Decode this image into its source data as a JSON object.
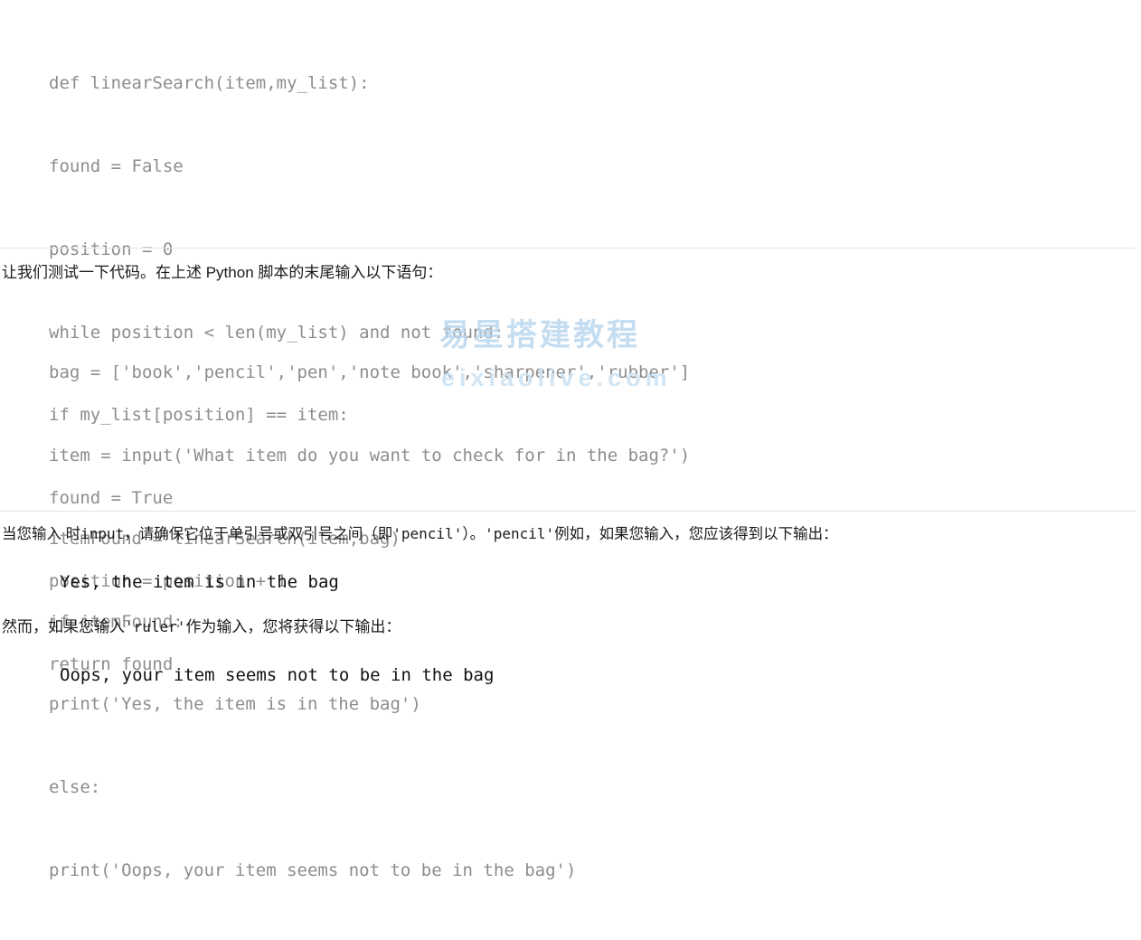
{
  "document": {
    "code_block_1": {
      "name": "linear-search-function",
      "lines": [
        "def linearSearch(item,my_list):",
        "found = False",
        "position = 0",
        "while position < len(my_list) and not found:",
        "if my_list[position] == item:",
        "found = True",
        "position = position + 1",
        "return found"
      ]
    },
    "paragraph_1": "让我们测试一下代码。在上述 Python 脚本的末尾输入以下语句：",
    "code_block_2": {
      "name": "linear-search-test-script",
      "lines": [
        "bag = ['book','pencil','pen','note book','sharpener','rubber']",
        "item = input('What item do you want to check for in the bag?')",
        "itemFound = linearSearch(item,bag)",
        "if itemFound:",
        "print('Yes, the item is in the bag')",
        "else:",
        "print('Oops, your item seems not to be in the bag')"
      ]
    },
    "paragraph_2": {
      "part_1": "当您输入 时",
      "code_1": "input",
      "part_2": "，请确保它位于单引号或双引号之间（即",
      "code_2": "'pencil'",
      "part_3": "）。",
      "code_3": "'pencil'",
      "part_4": "例如，如果您输入，您应该得到以下输出："
    },
    "output_1": "Yes, the item is in the bag",
    "paragraph_3": {
      "part_1": "然而，如果您输入",
      "code_1": "'ruler'",
      "part_2": "作为输入，您将获得以下输出："
    },
    "output_2": "Oops, your item seems not to be in the bag",
    "watermark": {
      "chinese": "易星搭建教程",
      "url": "eixiaolive.com"
    },
    "colors": {
      "code_text": "#8d8d8d",
      "body_text": "#1a1a1a",
      "output_text": "#111111",
      "divider": "#e4e4e4",
      "watermark_cn": "#bcd8ef",
      "watermark_url": "#cfe4f4",
      "background": "#ffffff"
    }
  }
}
